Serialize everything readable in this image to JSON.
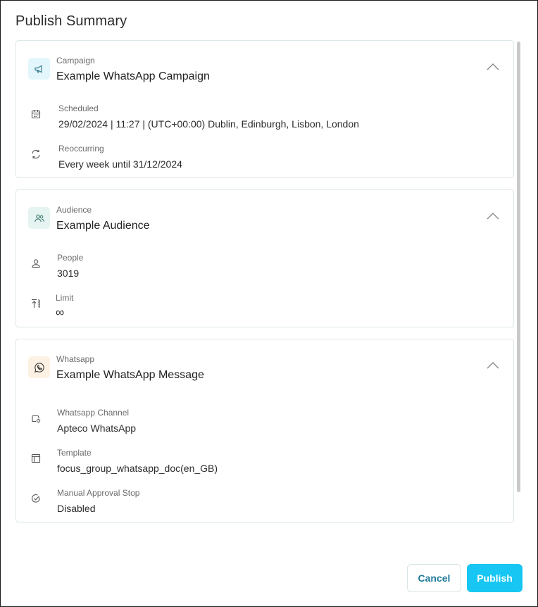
{
  "dialog": {
    "title": "Publish Summary"
  },
  "campaign": {
    "kicker": "Campaign",
    "title": "Example WhatsApp Campaign",
    "rows": [
      {
        "icon": "calendar-icon",
        "label": "Scheduled",
        "value": "29/02/2024 | 11:27 | (UTC+00:00) Dublin, Edinburgh, Lisbon, London"
      },
      {
        "icon": "refresh-icon",
        "label": "Reoccurring",
        "value": "Every week until 31/12/2024"
      }
    ]
  },
  "audience": {
    "kicker": "Audience",
    "title": "Example Audience",
    "rows": [
      {
        "icon": "person-icon",
        "label": "People",
        "value": "3019"
      },
      {
        "icon": "limit-icon",
        "label": "Limit",
        "value": "∞"
      }
    ]
  },
  "whatsapp": {
    "kicker": "Whatsapp",
    "title": "Example WhatsApp Message",
    "rows": [
      {
        "icon": "channel-icon",
        "label": "Whatsapp Channel",
        "value": "Apteco WhatsApp"
      },
      {
        "icon": "template-icon",
        "label": "Template",
        "value": "focus_group_whatsapp_doc(en_GB)"
      },
      {
        "icon": "check-circle-icon",
        "label": "Manual Approval Stop",
        "value": "Disabled"
      }
    ]
  },
  "footer": {
    "cancel_label": "Cancel",
    "publish_label": "Publish"
  },
  "colors": {
    "primary": "#17c6f2",
    "cancel_text": "#1f7a99",
    "campaign_icon_bg": "#e3f6fc",
    "audience_icon_bg": "#e6f4f1",
    "whatsapp_icon_bg": "#fdf1e4"
  }
}
